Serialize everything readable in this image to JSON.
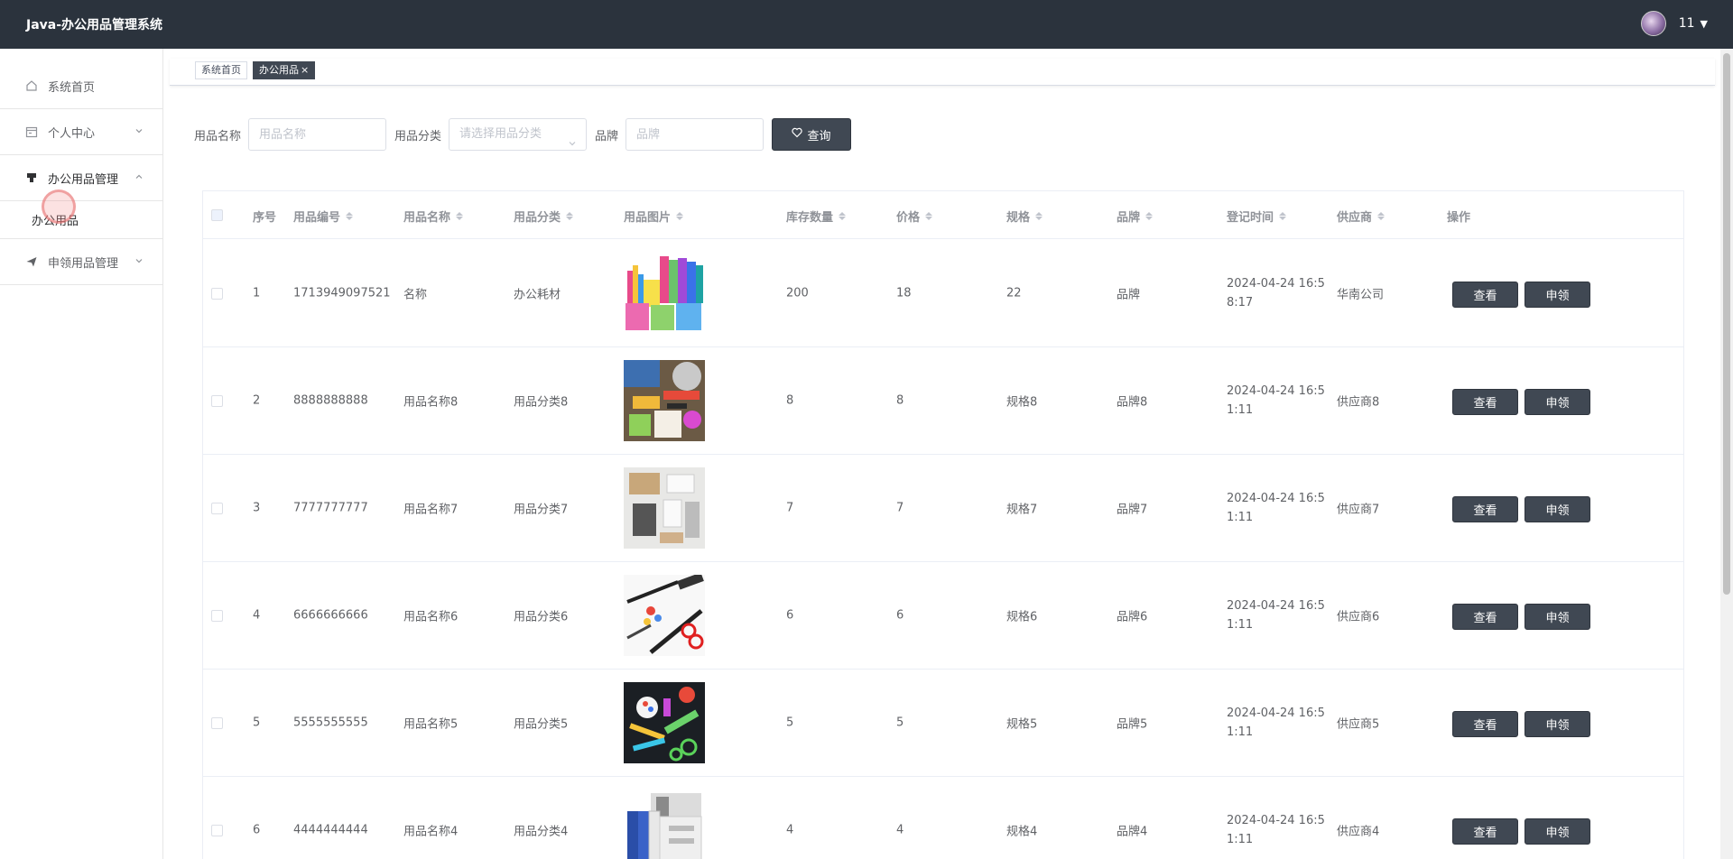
{
  "app": {
    "title": "Java-办公用品管理系统",
    "user": "11"
  },
  "sidebar": {
    "items": [
      {
        "label": "系统首页",
        "icon": "home-icon"
      },
      {
        "label": "个人中心",
        "icon": "calendar-icon"
      },
      {
        "label": "办公用品管理",
        "icon": "stamp-icon"
      },
      {
        "label": "办公用品",
        "icon": ""
      },
      {
        "label": "申领用品管理",
        "icon": "send-icon"
      }
    ]
  },
  "tabs": [
    {
      "label": "系统首页"
    },
    {
      "label": "办公用品",
      "close": "×"
    }
  ],
  "search": {
    "name_label": "用品名称",
    "name_placeholder": "用品名称",
    "category_label": "用品分类",
    "category_placeholder": "请选择用品分类",
    "brand_label": "品牌",
    "brand_placeholder": "品牌",
    "button": "查询"
  },
  "table": {
    "columns": [
      "序号",
      "用品编号",
      "用品名称",
      "用品分类",
      "用品图片",
      "库存数量",
      "价格",
      "规格",
      "品牌",
      "登记时间",
      "供应商",
      "操作"
    ],
    "rows": [
      {
        "index": "1",
        "code": "1713949097521",
        "name": "名称",
        "category": "办公耗材",
        "stock": "200",
        "price": "18",
        "spec": "22",
        "brand": "品牌",
        "time": "2024-04-24 16:58:17",
        "supplier": "华南公司",
        "image": "stationery-cups"
      },
      {
        "index": "2",
        "code": "8888888888",
        "name": "用品名称8",
        "category": "用品分类8",
        "stock": "8",
        "price": "8",
        "spec": "规格8",
        "brand": "品牌8",
        "time": "2024-04-24 16:51:11",
        "supplier": "供应商8",
        "image": "desk-supplies"
      },
      {
        "index": "3",
        "code": "7777777777",
        "name": "用品名称7",
        "category": "用品分类7",
        "stock": "7",
        "price": "7",
        "spec": "规格7",
        "brand": "品牌7",
        "time": "2024-04-24 16:51:11",
        "supplier": "供应商7",
        "image": "white-desk"
      },
      {
        "index": "4",
        "code": "6666666666",
        "name": "用品名称6",
        "category": "用品分类6",
        "stock": "6",
        "price": "6",
        "spec": "规格6",
        "brand": "品牌6",
        "time": "2024-04-24 16:51:11",
        "supplier": "供应商6",
        "image": "scissors-pens"
      },
      {
        "index": "5",
        "code": "5555555555",
        "name": "用品名称5",
        "category": "用品分类5",
        "stock": "5",
        "price": "5",
        "spec": "规格5",
        "brand": "品牌5",
        "time": "2024-04-24 16:51:11",
        "supplier": "供应商5",
        "image": "colorful-supplies"
      },
      {
        "index": "6",
        "code": "4444444444",
        "name": "用品名称4",
        "category": "用品分类4",
        "stock": "4",
        "price": "4",
        "spec": "规格4",
        "brand": "品牌4",
        "time": "2024-04-24 16:51:11",
        "supplier": "供应商4",
        "image": "file-organizer"
      }
    ],
    "view_label": "查看",
    "apply_label": "申领"
  },
  "colors": {
    "header_bg": "#2b333d",
    "button_bg": "#404853",
    "text": "#606266"
  }
}
